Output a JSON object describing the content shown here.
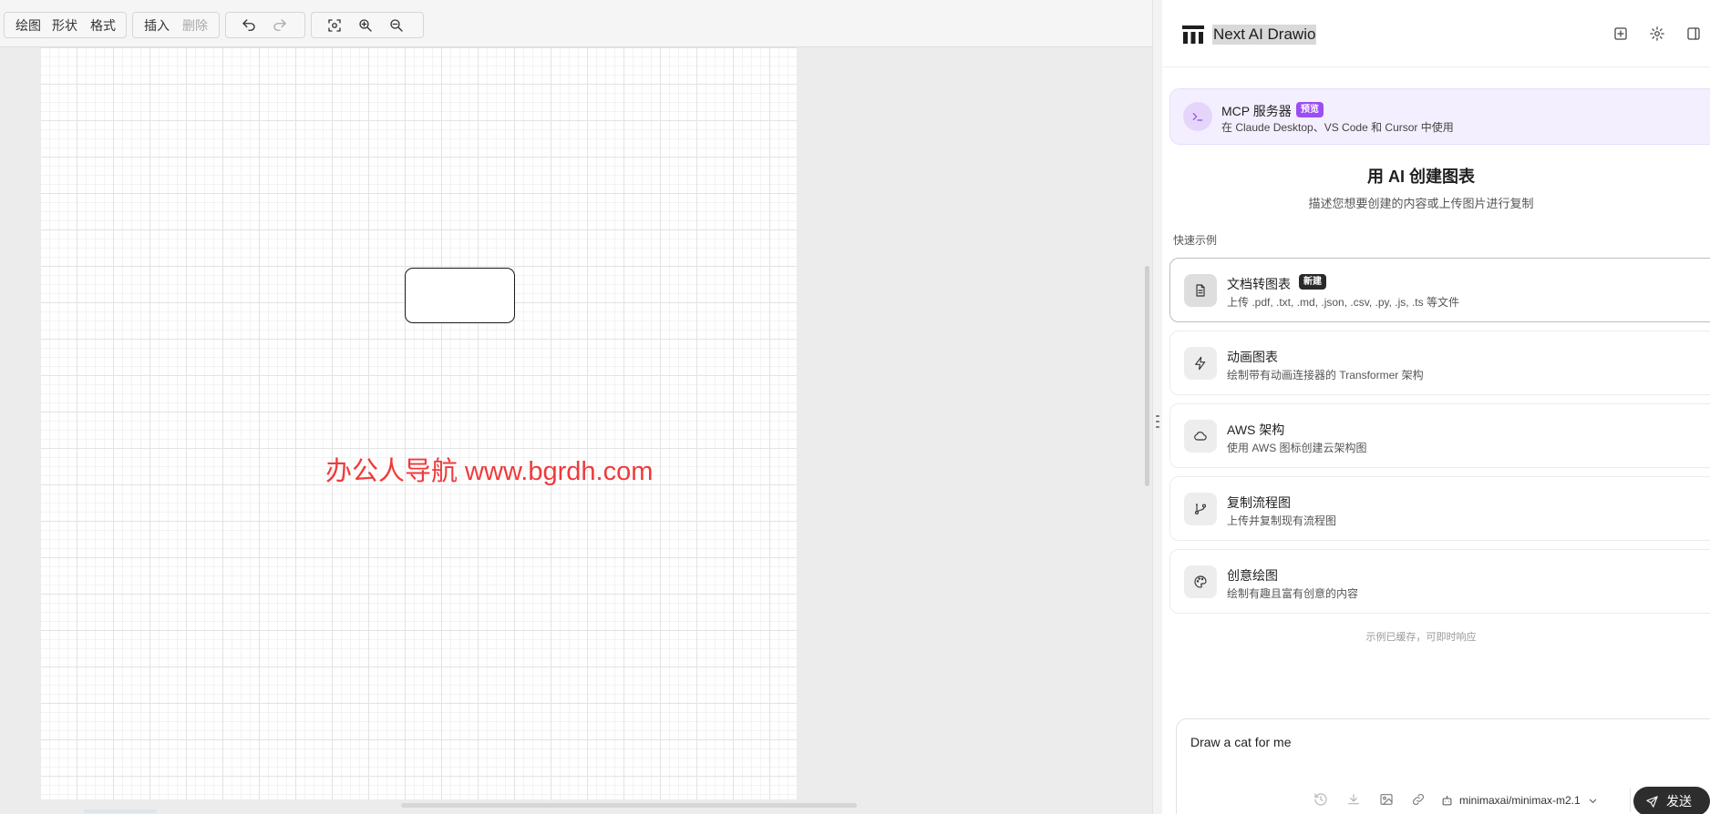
{
  "toolbar": {
    "menu": [
      "绘图",
      "形状",
      "格式"
    ],
    "edit": [
      "插入",
      "删除"
    ]
  },
  "canvas": {
    "watermark": "办公人导航 www.bgrdh.com"
  },
  "panel": {
    "app_title": "Next AI Drawio",
    "mcp": {
      "title": "MCP 服务器",
      "badge": "预览",
      "subtitle": "在 Claude Desktop、VS Code 和 Cursor 中使用"
    },
    "hero": {
      "title": "用 AI 创建图表",
      "subtitle": "描述您想要创建的内容或上传图片进行复制"
    },
    "quick_label": "快速示例",
    "cards": [
      {
        "title": "文档转图表",
        "badge": "新建",
        "desc": "上传 .pdf, .txt, .md, .json, .csv, .py, .js, .ts 等文件",
        "icon": "file-text-icon"
      },
      {
        "title": "动画图表",
        "desc": "绘制带有动画连接器的 Transformer 架构",
        "icon": "zap-icon"
      },
      {
        "title": "AWS 架构",
        "desc": "使用 AWS 图标创建云架构图",
        "icon": "cloud-icon"
      },
      {
        "title": "复制流程图",
        "desc": "上传并复制现有流程图",
        "icon": "git-branch-icon"
      },
      {
        "title": "创意绘图",
        "desc": "绘制有趣且富有创意的内容",
        "icon": "palette-icon"
      }
    ],
    "cache_note": "示例已缓存，可即时响应",
    "input": {
      "value": "Draw a cat for me"
    },
    "model": "minimaxai/minimax-m2.1",
    "send_label": "发送"
  }
}
